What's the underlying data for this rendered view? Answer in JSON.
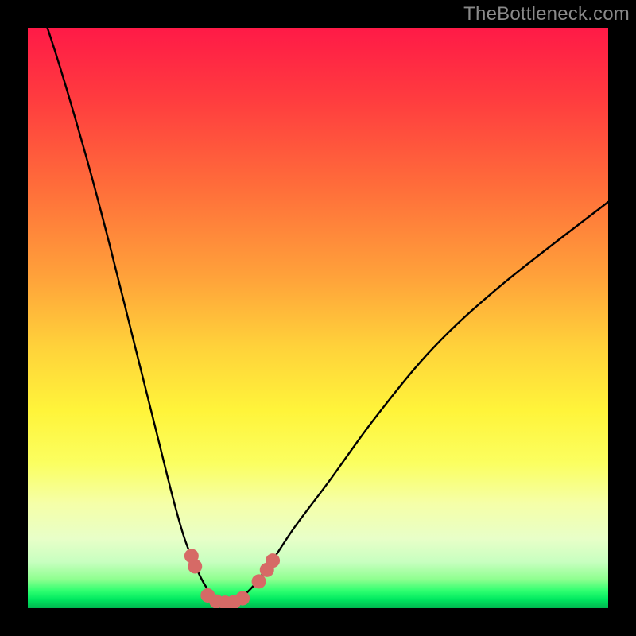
{
  "watermark": "TheBottleneck.com",
  "chart_data": {
    "type": "line",
    "title": "",
    "xlabel": "",
    "ylabel": "",
    "x_range": [
      0,
      100
    ],
    "y_range": [
      0,
      100
    ],
    "series": [
      {
        "name": "curve",
        "x": [
          0,
          5,
          10,
          14,
          18,
          22,
          25,
          27,
          29,
          30.5,
          32,
          33,
          34,
          35,
          36,
          37,
          39,
          42,
          46,
          52,
          60,
          70,
          82,
          100
        ],
        "y": [
          110,
          95,
          78,
          63,
          47,
          31,
          19,
          12,
          7,
          4,
          2,
          1.2,
          1,
          1,
          1.2,
          2,
          4,
          8,
          14,
          22,
          33,
          45,
          56,
          70
        ]
      }
    ],
    "markers": {
      "name": "beads",
      "points": [
        {
          "x": 28.2,
          "y": 9.0
        },
        {
          "x": 28.8,
          "y": 7.2
        },
        {
          "x": 31.0,
          "y": 2.2
        },
        {
          "x": 32.5,
          "y": 1.15
        },
        {
          "x": 34.0,
          "y": 0.95
        },
        {
          "x": 35.5,
          "y": 1.05
        },
        {
          "x": 37.0,
          "y": 1.7
        },
        {
          "x": 39.8,
          "y": 4.6
        },
        {
          "x": 41.2,
          "y": 6.6
        },
        {
          "x": 42.2,
          "y": 8.2
        }
      ]
    },
    "colors": {
      "curve": "#000000",
      "marker": "#d66a66",
      "gradient_top": "#ff1a47",
      "gradient_bottom": "#00b850"
    }
  }
}
